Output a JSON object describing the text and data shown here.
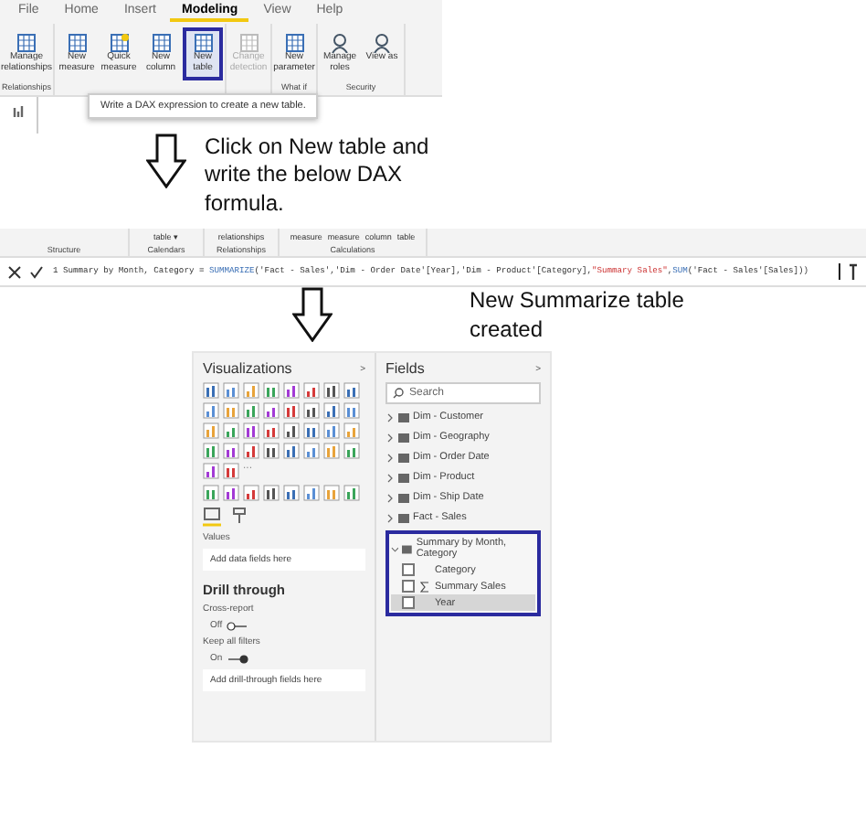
{
  "ribbon": {
    "tabs": [
      {
        "label": "File",
        "selected": false
      },
      {
        "label": "Home",
        "selected": false
      },
      {
        "label": "Insert",
        "selected": false
      },
      {
        "label": "Modeling",
        "selected": true
      },
      {
        "label": "View",
        "selected": false
      },
      {
        "label": "Help",
        "selected": false
      }
    ],
    "groups": [
      {
        "label": "Relationships",
        "buttons": [
          {
            "label": "Manage relationships",
            "kind": "relations",
            "highlighted": false,
            "disabled": false
          }
        ]
      },
      {
        "buttons": [
          {
            "label": "New measure",
            "kind": "calc",
            "highlighted": false,
            "disabled": false
          },
          {
            "label": "Quick measure",
            "kind": "quick",
            "highlighted": false,
            "disabled": false
          },
          {
            "label": "New column",
            "kind": "column",
            "highlighted": false,
            "disabled": false
          },
          {
            "label": "New table",
            "kind": "table",
            "highlighted": true,
            "disabled": false
          }
        ]
      },
      {
        "buttons": [
          {
            "label": "Change detection",
            "kind": "detect",
            "highlighted": false,
            "disabled": true
          }
        ]
      },
      {
        "label": "What if",
        "buttons": [
          {
            "label": "New parameter",
            "kind": "param",
            "highlighted": false,
            "disabled": false
          }
        ]
      },
      {
        "label": "Security",
        "buttons": [
          {
            "label": "Manage roles",
            "kind": "user",
            "highlighted": false,
            "disabled": false
          },
          {
            "label": "View as",
            "kind": "user",
            "highlighted": false,
            "disabled": false
          }
        ]
      }
    ],
    "tooltip": "Write a DAX expression to create a new table."
  },
  "step1": "Click on New table and write the below DAX formula.",
  "ribbon2": {
    "groups": [
      {
        "label": "Structure"
      },
      {
        "label": "Calendars",
        "buttons": [
          "table ▾"
        ]
      },
      {
        "label": "Relationships",
        "buttons": [
          "relationships"
        ]
      },
      {
        "label": "Calculations",
        "buttons": [
          "measure",
          "measure",
          "column",
          "table"
        ]
      }
    ]
  },
  "formula": {
    "line": "1",
    "name": "Summary by Month, Category = ",
    "func": "SUMMARIZE",
    "args1": "('Fact - Sales','Dim - Order Date'[Year],'Dim - Product'[Category],",
    "str": "\"Summary Sales\"",
    "args2": ",",
    "func2": "SUM",
    "args3": "('Fact - Sales'[Sales]))"
  },
  "step2": "New Summarize table created",
  "visualizations": {
    "title": "Visualizations",
    "collapse": ">",
    "more": "···",
    "values_label": "Values",
    "values_placeholder": "Add data fields here",
    "drill_title": "Drill through",
    "cross_report": {
      "label": "Cross-report",
      "state": "Off",
      "on": false
    },
    "keep_filters": {
      "label": "Keep all filters",
      "state": "On",
      "on": true
    },
    "drill_placeholder": "Add drill-through fields here"
  },
  "fields": {
    "title": "Fields",
    "collapse": ">",
    "search_placeholder": "Search",
    "tables": [
      {
        "name": "Dim - Customer",
        "expanded": false
      },
      {
        "name": "Dim - Geography",
        "expanded": false
      },
      {
        "name": "Dim - Order Date",
        "expanded": false
      },
      {
        "name": "Dim - Product",
        "expanded": false
      },
      {
        "name": "Dim - Ship Date",
        "expanded": false
      },
      {
        "name": "Fact - Sales",
        "expanded": false
      },
      {
        "name": "Summary by Month, Category",
        "expanded": true,
        "children": [
          {
            "name": "Category",
            "kind": "text",
            "checked": false,
            "selected": false
          },
          {
            "name": "Summary Sales",
            "kind": "measure",
            "checked": false,
            "selected": false
          },
          {
            "name": "Year",
            "kind": "text",
            "checked": false,
            "selected": true
          }
        ]
      }
    ]
  }
}
